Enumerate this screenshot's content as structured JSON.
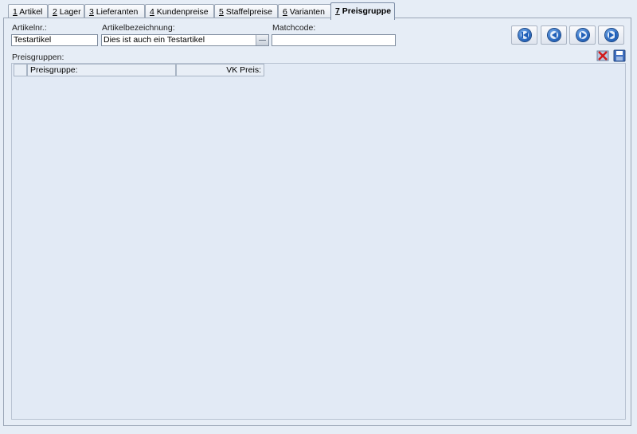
{
  "tabs": [
    {
      "key": "1",
      "label": "Artikel"
    },
    {
      "key": "2",
      "label": "Lager"
    },
    {
      "key": "3",
      "label": "Lieferanten"
    },
    {
      "key": "4",
      "label": "Kundenpreise"
    },
    {
      "key": "5",
      "label": "Staffelpreise"
    },
    {
      "key": "6",
      "label": "Varianten"
    },
    {
      "key": "7",
      "label": "Preisgruppe",
      "active": true
    }
  ],
  "form": {
    "artikelnr_label": "Artikelnr.:",
    "artikelnr_value": "Testartikel",
    "bezeichnung_label": "Artikelbezeichnung:",
    "bezeichnung_value": "Dies ist auch ein Testartikel",
    "matchcode_label": "Matchcode:",
    "matchcode_value": ""
  },
  "nav_buttons": [
    "first-icon",
    "previous-icon",
    "next-icon",
    "last-icon"
  ],
  "section": {
    "label": "Preisgruppen:",
    "delete_icon": "delete-icon",
    "save_icon": "save-icon"
  },
  "grid": {
    "columns": [
      "Preisgruppe:",
      "VK Preis:"
    ],
    "rows": []
  }
}
